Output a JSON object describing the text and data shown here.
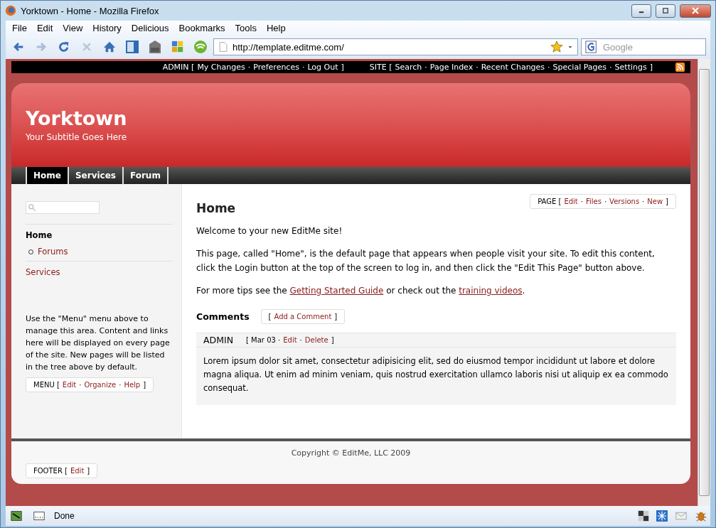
{
  "window": {
    "title": "Yorktown - Home - Mozilla Firefox"
  },
  "menu": [
    "File",
    "Edit",
    "View",
    "History",
    "Delicious",
    "Bookmarks",
    "Tools",
    "Help"
  ],
  "address": {
    "value": "http://template.editme.com/"
  },
  "search": {
    "placeholder": "Google"
  },
  "admin_bar": [
    [
      {
        "kind": "text",
        "text": "ADMIN ["
      },
      {
        "kind": "link",
        "text": "My Changes"
      },
      {
        "kind": "text",
        "text": "·"
      },
      {
        "kind": "link",
        "text": "Preferences"
      },
      {
        "kind": "text",
        "text": "·"
      },
      {
        "kind": "link",
        "text": "Log Out"
      },
      {
        "kind": "text",
        "text": "]"
      }
    ],
    [
      {
        "kind": "text",
        "text": "SITE ["
      },
      {
        "kind": "link",
        "text": "Search"
      },
      {
        "kind": "text",
        "text": "·"
      },
      {
        "kind": "link",
        "text": "Page Index"
      },
      {
        "kind": "text",
        "text": "·"
      },
      {
        "kind": "link",
        "text": "Recent Changes"
      },
      {
        "kind": "text",
        "text": "·"
      },
      {
        "kind": "link",
        "text": "Special Pages"
      },
      {
        "kind": "text",
        "text": "·"
      },
      {
        "kind": "link",
        "text": "Settings"
      },
      {
        "kind": "text",
        "text": "]"
      }
    ]
  ],
  "header": {
    "title": "Yorktown",
    "subtitle": "Your Subtitle Goes Here"
  },
  "tabs": [
    {
      "label": "Home",
      "selected": true
    },
    {
      "label": "Services",
      "selected": false
    },
    {
      "label": "Forum",
      "selected": false
    }
  ],
  "sidebar": {
    "tree": [
      {
        "label": "Home",
        "selected": true,
        "children": [
          {
            "label": "Forums",
            "selected": false
          }
        ]
      },
      {
        "label": "Services",
        "selected": false
      }
    ],
    "note": "Use the \"Menu\" menu above to manage this area. Content and links here will be displayed on every page of the site. New pages will be listed in the tree above by default.",
    "menu_box": [
      {
        "kind": "text",
        "text": "MENU ["
      },
      {
        "kind": "link",
        "text": "Edit"
      },
      {
        "kind": "text",
        "text": "·"
      },
      {
        "kind": "link",
        "text": "Organize"
      },
      {
        "kind": "text",
        "text": "·"
      },
      {
        "kind": "link",
        "text": "Help"
      },
      {
        "kind": "text",
        "text": "]"
      }
    ]
  },
  "main": {
    "title": "Home",
    "page_box": [
      {
        "kind": "text",
        "text": "PAGE ["
      },
      {
        "kind": "link",
        "text": "Edit"
      },
      {
        "kind": "text",
        "text": "·"
      },
      {
        "kind": "link",
        "text": "Files"
      },
      {
        "kind": "text",
        "text": "·"
      },
      {
        "kind": "link",
        "text": "Versions"
      },
      {
        "kind": "text",
        "text": "·"
      },
      {
        "kind": "link",
        "text": "New"
      },
      {
        "kind": "text",
        "text": "]"
      }
    ],
    "paragraphs": [
      [
        {
          "kind": "text",
          "text": "Welcome to your new EditMe site!"
        }
      ],
      [
        {
          "kind": "text",
          "text": "This page, called \"Home\", is the default page that appears when people visit your site. To edit this content, click the Login button at the top of the screen to log in, and then click the \"Edit This Page\" button above."
        }
      ],
      [
        {
          "kind": "text",
          "text": "For more tips see the "
        },
        {
          "kind": "link",
          "text": "Getting Started Guide"
        },
        {
          "kind": "text",
          "text": " or check out the "
        },
        {
          "kind": "link",
          "text": "training videos"
        },
        {
          "kind": "text",
          "text": "."
        }
      ]
    ],
    "comments_title": "Comments",
    "add_comment": [
      {
        "kind": "text",
        "text": "["
      },
      {
        "kind": "link",
        "text": "Add a Comment"
      },
      {
        "kind": "text",
        "text": "]"
      }
    ],
    "comments": [
      {
        "author": "ADMIN",
        "meta": [
          {
            "kind": "text",
            "text": "[ Mar 03 ·"
          },
          {
            "kind": "link",
            "text": "Edit"
          },
          {
            "kind": "text",
            "text": "·"
          },
          {
            "kind": "link",
            "text": "Delete"
          },
          {
            "kind": "text",
            "text": "]"
          }
        ],
        "body": "Lorem ipsum dolor sit amet, consectetur adipisicing elit, sed do eiusmod tempor incididunt ut labore et dolore magna aliqua. Ut enim ad minim veniam, quis nostrud exercitation ullamco laboris nisi ut aliquip ex ea commodo consequat."
      }
    ]
  },
  "footer": {
    "copyright": "Copyright © EditMe, LLC 2009",
    "box": [
      {
        "kind": "text",
        "text": "FOOTER ["
      },
      {
        "kind": "link",
        "text": "Edit"
      },
      {
        "kind": "text",
        "text": "]"
      }
    ]
  },
  "status_bar": {
    "text": "Done"
  }
}
